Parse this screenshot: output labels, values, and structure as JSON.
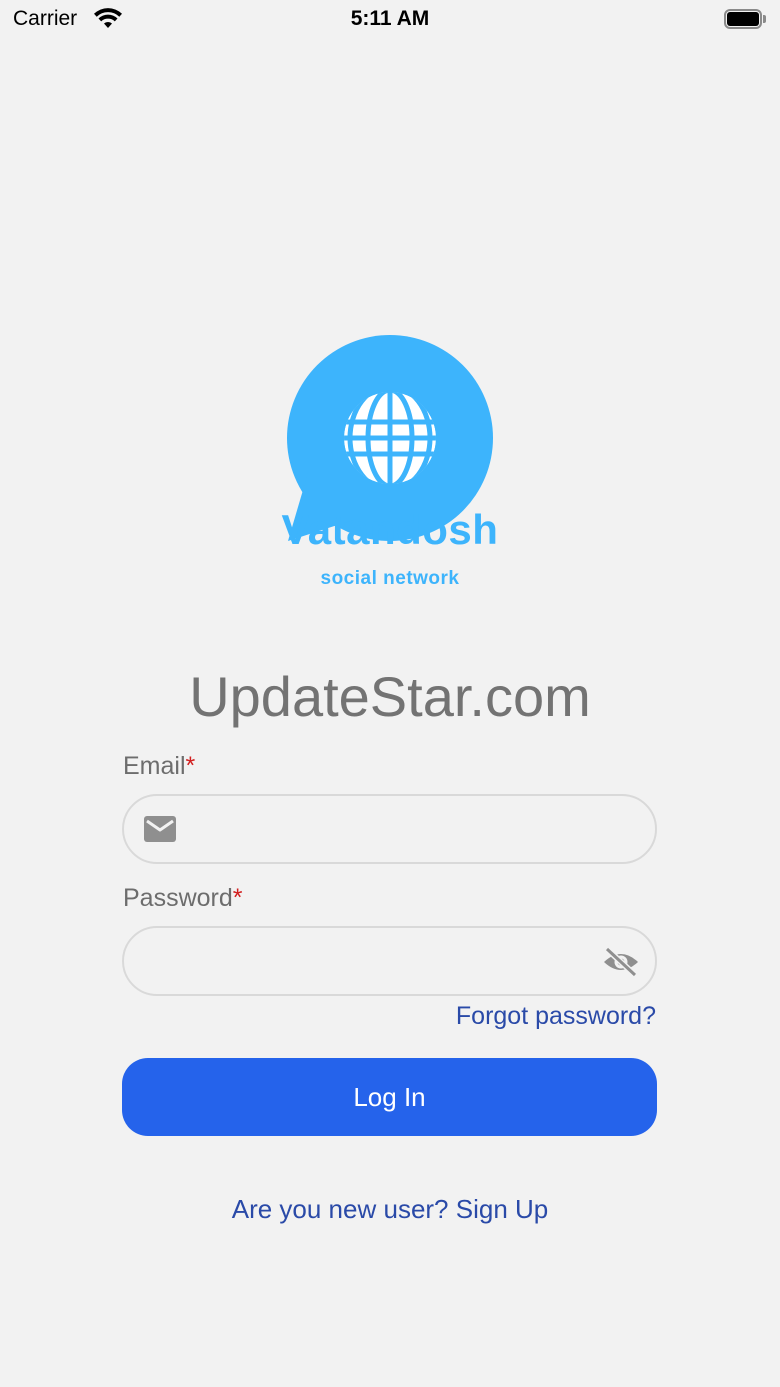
{
  "status_bar": {
    "carrier": "Carrier",
    "time": "5:11 AM",
    "icons": [
      "wifi-icon",
      "battery-icon"
    ]
  },
  "brand": {
    "name": "Vatandosh",
    "tagline": "social network",
    "logo_icon": "globe-chat-bubble-icon",
    "color": "#3db4fc"
  },
  "watermark": "UpdateStar.com",
  "form": {
    "email": {
      "label": "Email",
      "required_mark": "*",
      "value": "",
      "icon": "mail-icon"
    },
    "password": {
      "label": "Password",
      "required_mark": "*",
      "value": "",
      "icon": "eye-off-icon"
    },
    "forgot_password": "Forgot password?",
    "login_button": "Log In",
    "signup_link": "Are you new user? Sign Up"
  },
  "colors": {
    "background": "#f2f2f2",
    "primary_button": "#2563eb",
    "link": "#2a4aa8",
    "required": "#d21f1f"
  }
}
